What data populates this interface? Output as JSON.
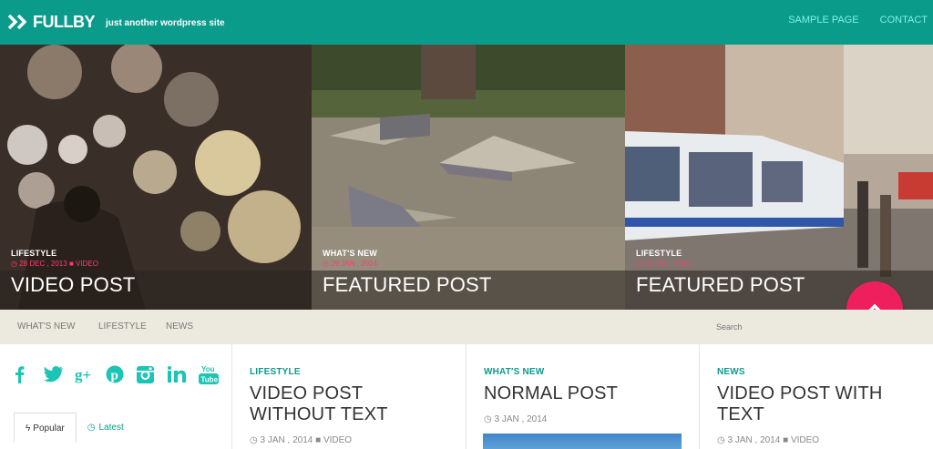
{
  "header": {
    "logo": "FULLBY",
    "tagline": "just another wordpress site",
    "nav": [
      "SAMPLE PAGE",
      "CONTACT"
    ]
  },
  "slides": [
    {
      "category": "LIFESTYLE",
      "date": "28 DEC , 2013",
      "type": "VIDEO",
      "title": "VIDEO POST"
    },
    {
      "category": "WHAT'S NEW",
      "date": "29 JAN , 2014",
      "type": "",
      "title": "FEATURED POST"
    },
    {
      "category": "LIFESTYLE",
      "date": "30 JAN , 2014",
      "type": "",
      "title": "FEATURED POST"
    }
  ],
  "subnav": {
    "items": [
      "WHAT'S NEW",
      "LIFESTYLE",
      "NEWS"
    ],
    "search_placeholder": "Search"
  },
  "sidebar": {
    "social": [
      "facebook-icon",
      "twitter-icon",
      "google-plus-icon",
      "pinterest-icon",
      "instagram-icon",
      "linkedin-icon",
      "youtube-icon"
    ],
    "tabs": [
      "Popular",
      "Latest"
    ]
  },
  "posts": [
    {
      "category": "LIFESTYLE",
      "title": "VIDEO POST WITHOUT TEXT",
      "title_line1": "VIDEO POST",
      "title_line2": "WITHOUT TEXT",
      "date": "3 JAN , 2014",
      "type": "VIDEO"
    },
    {
      "category": "WHAT'S NEW",
      "title": "NORMAL POST",
      "date": "3 JAN , 2014"
    },
    {
      "category": "NEWS",
      "title_line1": "VIDEO POST WITH",
      "title_line2": "TEXT",
      "date": "3 JAN , 2014",
      "type": "VIDEO"
    }
  ],
  "colors": {
    "accent": "#0b9b8b",
    "highlight": "#ef1f5d",
    "subnav_bg": "#eceadf"
  }
}
